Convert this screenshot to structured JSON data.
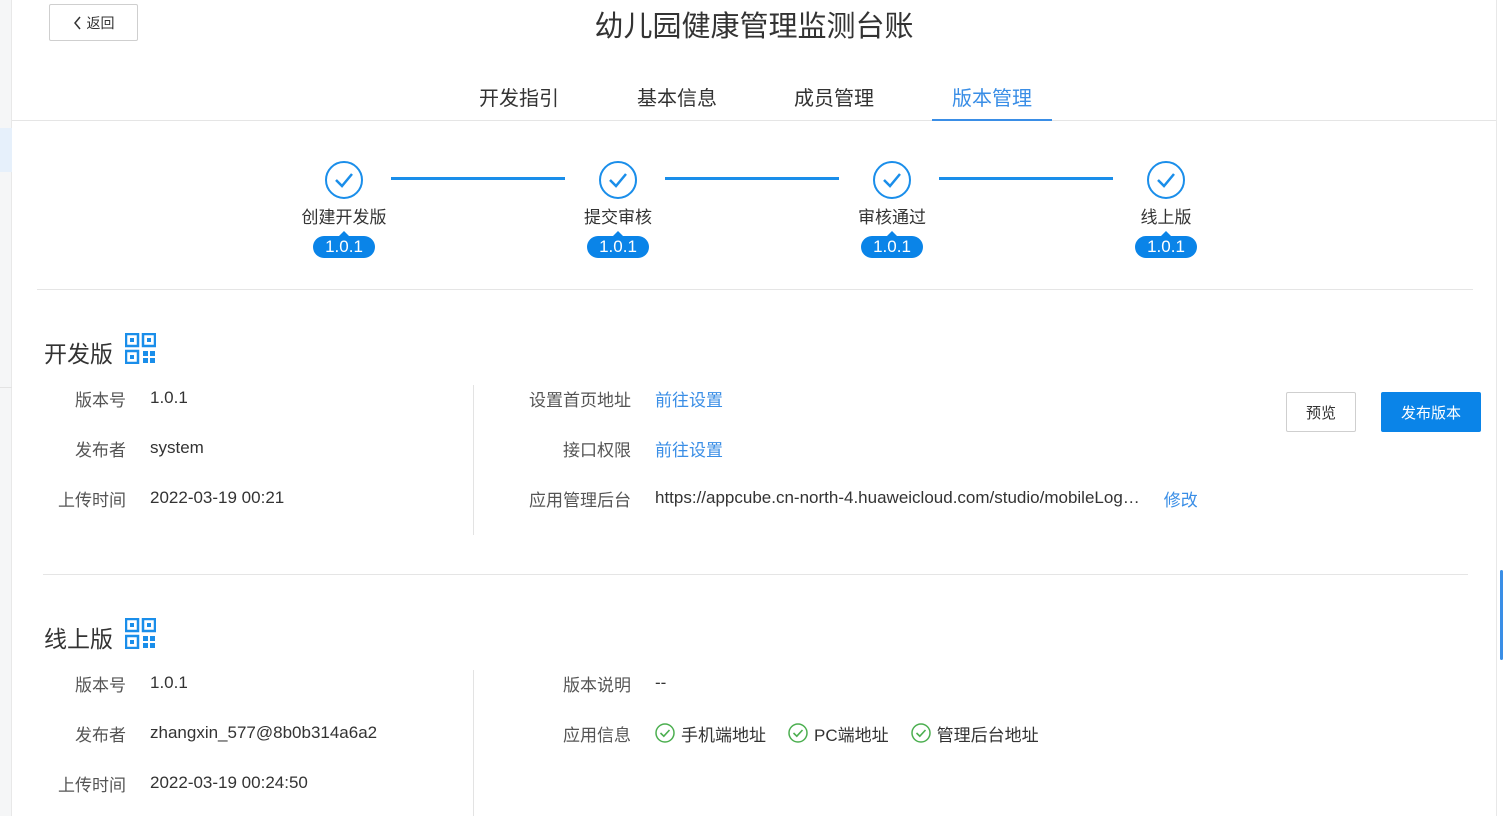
{
  "header": {
    "back_label": "返回",
    "title": "幼儿园健康管理监测台账"
  },
  "tabs": [
    {
      "label": "开发指引",
      "active": false
    },
    {
      "label": "基本信息",
      "active": false
    },
    {
      "label": "成员管理",
      "active": false
    },
    {
      "label": "版本管理",
      "active": true
    }
  ],
  "steps": [
    {
      "label": "创建开发版",
      "version": "1.0.1",
      "done": true
    },
    {
      "label": "提交审核",
      "version": "1.0.1",
      "done": true
    },
    {
      "label": "审核通过",
      "version": "1.0.1",
      "done": true
    },
    {
      "label": "线上版",
      "version": "1.0.1",
      "done": true
    }
  ],
  "dev": {
    "title": "开发版",
    "version_key": "版本号",
    "version_value": "1.0.1",
    "publisher_key": "发布者",
    "publisher_value": "system",
    "upload_key": "上传时间",
    "upload_value": "2022-03-19 00:21",
    "homepage_key": "设置首页地址",
    "homepage_link": "前往设置",
    "api_key": "接口权限",
    "api_link": "前往设置",
    "admin_key": "应用管理后台",
    "admin_value": "https://appcube.cn-north-4.huaweicloud.com/studio/mobileLog…",
    "admin_edit": "修改",
    "preview_label": "预览",
    "publish_label": "发布版本"
  },
  "online": {
    "title": "线上版",
    "version_key": "版本号",
    "version_value": "1.0.1",
    "publisher_key": "发布者",
    "publisher_value": "zhangxin_577@8b0b314a6a2",
    "upload_key": "上传时间",
    "upload_value": "2022-03-19 00:24:50",
    "desc_key": "版本说明",
    "desc_value": "--",
    "info_key": "应用信息",
    "info_items": [
      "手机端地址",
      "PC端地址",
      "管理后台地址"
    ]
  },
  "colors": {
    "accent": "#3a8ee6",
    "primary_button": "#0a84e8",
    "success": "#4caf50"
  }
}
